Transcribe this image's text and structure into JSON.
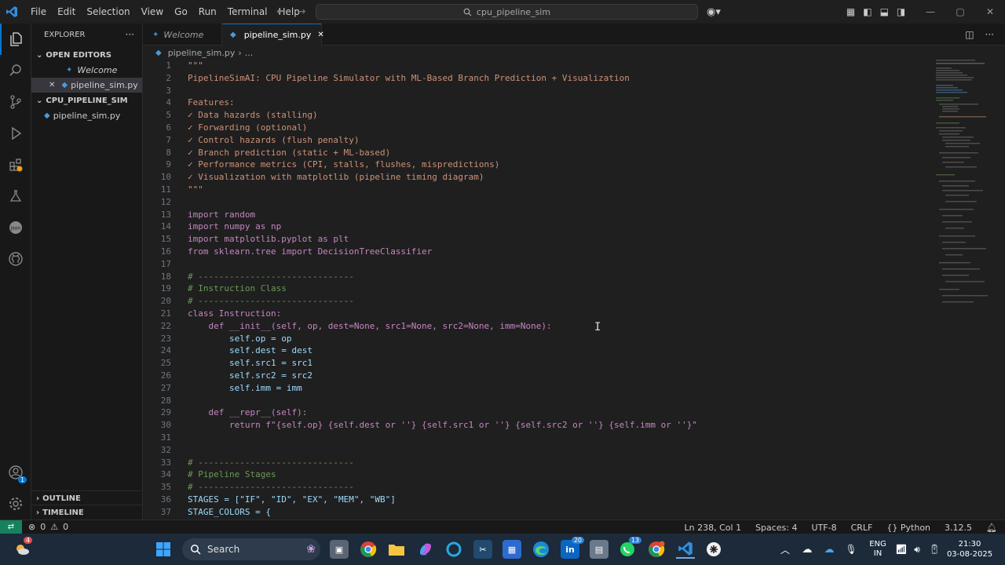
{
  "titlebar": {
    "menu": [
      "File",
      "Edit",
      "Selection",
      "View",
      "Go",
      "Run",
      "Terminal",
      "Help"
    ],
    "search_text": "cpu_pipeline_sim"
  },
  "sidebar": {
    "header": "EXPLORER",
    "open_editors_label": "OPEN EDITORS",
    "open_editors": [
      "Welcome",
      "pipeline_sim.py"
    ],
    "folder_label": "CPU_PIPELINE_SIM",
    "folder_files": [
      "pipeline_sim.py"
    ],
    "outline_label": "OUTLINE",
    "timeline_label": "TIMELINE"
  },
  "tabs": [
    {
      "label": "Welcome",
      "active": false
    },
    {
      "label": "pipeline_sim.py",
      "active": true
    }
  ],
  "breadcrumb": {
    "file": "pipeline_sim.py",
    "rest": "..."
  },
  "code_lines": [
    {
      "n": "1",
      "t": "\"\"\""
    },
    {
      "n": "2",
      "t": "PipelineSimAI: CPU Pipeline Simulator with ML-Based Branch Prediction + Visualization"
    },
    {
      "n": "3",
      "t": ""
    },
    {
      "n": "4",
      "t": "Features:"
    },
    {
      "n": "5",
      "t": "✓ Data hazards (stalling)"
    },
    {
      "n": "6",
      "t": "✓ Forwarding (optional)"
    },
    {
      "n": "7",
      "t": "✓ Control hazards (flush penalty)"
    },
    {
      "n": "8",
      "t": "✓ Branch prediction (static + ML-based)"
    },
    {
      "n": "9",
      "t": "✓ Performance metrics (CPI, stalls, flushes, mispredictions)"
    },
    {
      "n": "10",
      "t": "✓ Visualization with matplotlib (pipeline timing diagram)"
    },
    {
      "n": "11",
      "t": "\"\"\""
    },
    {
      "n": "12",
      "t": ""
    },
    {
      "n": "13",
      "t": "import random"
    },
    {
      "n": "14",
      "t": "import numpy as np"
    },
    {
      "n": "15",
      "t": "import matplotlib.pyplot as plt"
    },
    {
      "n": "16",
      "t": "from sklearn.tree import DecisionTreeClassifier"
    },
    {
      "n": "17",
      "t": ""
    },
    {
      "n": "18",
      "t": "# ------------------------------"
    },
    {
      "n": "19",
      "t": "# Instruction Class"
    },
    {
      "n": "20",
      "t": "# ------------------------------"
    },
    {
      "n": "21",
      "t": "class Instruction:"
    },
    {
      "n": "22",
      "t": "    def __init__(self, op, dest=None, src1=None, src2=None, imm=None):"
    },
    {
      "n": "23",
      "t": "        self.op = op"
    },
    {
      "n": "24",
      "t": "        self.dest = dest"
    },
    {
      "n": "25",
      "t": "        self.src1 = src1"
    },
    {
      "n": "26",
      "t": "        self.src2 = src2"
    },
    {
      "n": "27",
      "t": "        self.imm = imm"
    },
    {
      "n": "28",
      "t": ""
    },
    {
      "n": "29",
      "t": "    def __repr__(self):"
    },
    {
      "n": "30",
      "t": "        return f\"{self.op} {self.dest or ''} {self.src1 or ''} {self.src2 or ''} {self.imm or ''}\""
    },
    {
      "n": "31",
      "t": ""
    },
    {
      "n": "32",
      "t": ""
    },
    {
      "n": "33",
      "t": "# ------------------------------"
    },
    {
      "n": "34",
      "t": "# Pipeline Stages"
    },
    {
      "n": "35",
      "t": "# ------------------------------"
    },
    {
      "n": "36",
      "t": "STAGES = [\"IF\", \"ID\", \"EX\", \"MEM\", \"WB\"]"
    },
    {
      "n": "37",
      "t": "STAGE_COLORS = {"
    }
  ],
  "statusbar": {
    "errors": "0",
    "warnings": "0",
    "position": "Ln 238, Col 1",
    "spaces": "Spaces: 4",
    "encoding": "UTF-8",
    "eol": "CRLF",
    "language": "Python",
    "version": "3.12.5"
  },
  "taskbar": {
    "search_label": "Search",
    "lang_top": "ENG",
    "lang_bottom": "IN",
    "time": "21:30",
    "date": "03-08-2025",
    "weather_badge": "4",
    "news_badge": "20",
    "whatsapp_badge": "13"
  },
  "accounts_badge": "1"
}
